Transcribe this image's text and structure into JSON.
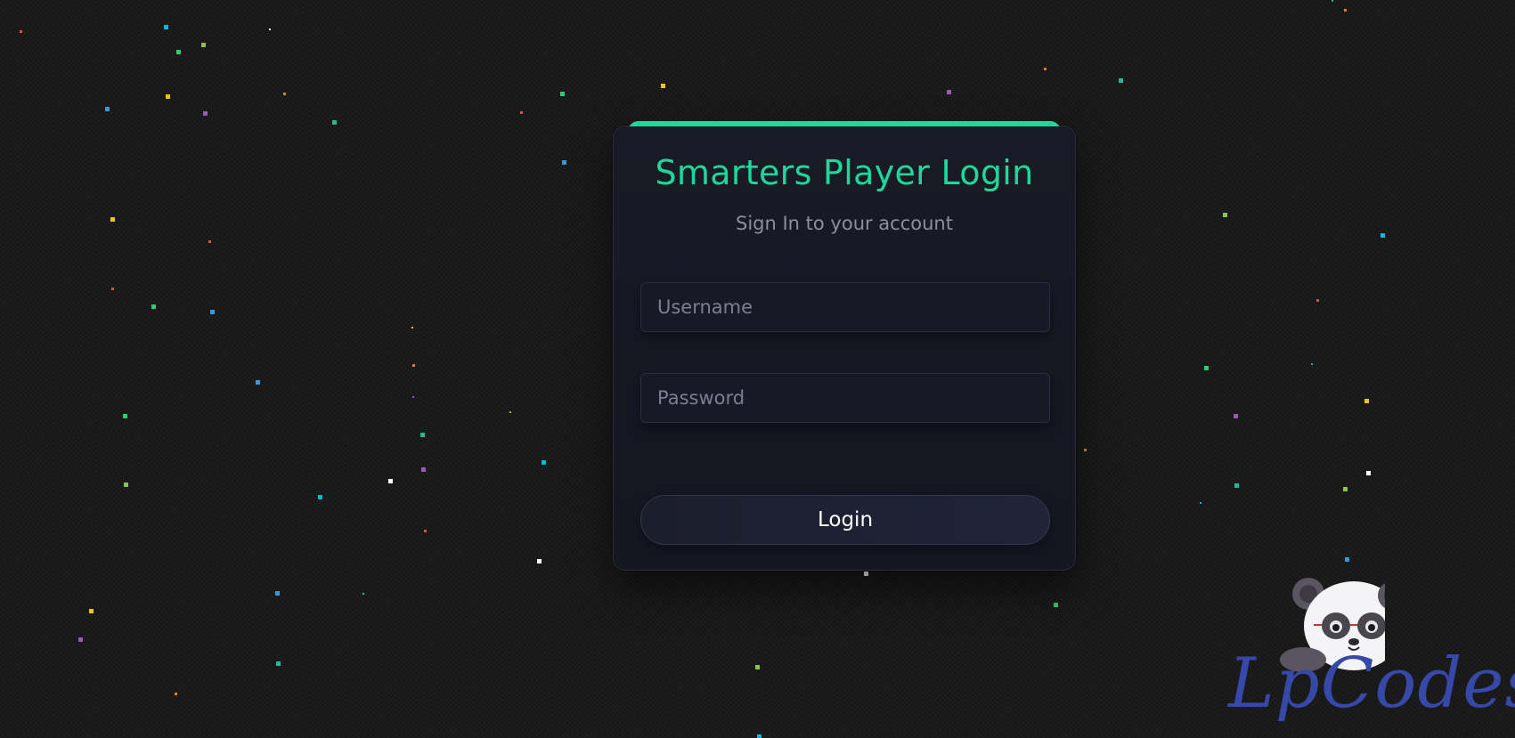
{
  "login": {
    "title": "Smarters Player Login",
    "subtitle": "Sign In to your account",
    "username_placeholder": "Username",
    "password_placeholder": "Password",
    "username_value": "",
    "password_value": "",
    "submit_label": "Login"
  },
  "branding": {
    "logo_text": "LpCodes",
    "mascot": "panda-mascot-icon"
  },
  "colors": {
    "accent": "#1ed79a",
    "background": "#1a1a1a",
    "card": "#171925",
    "logo_text": "#3648a8",
    "subtitle": "#8b8f9e"
  }
}
